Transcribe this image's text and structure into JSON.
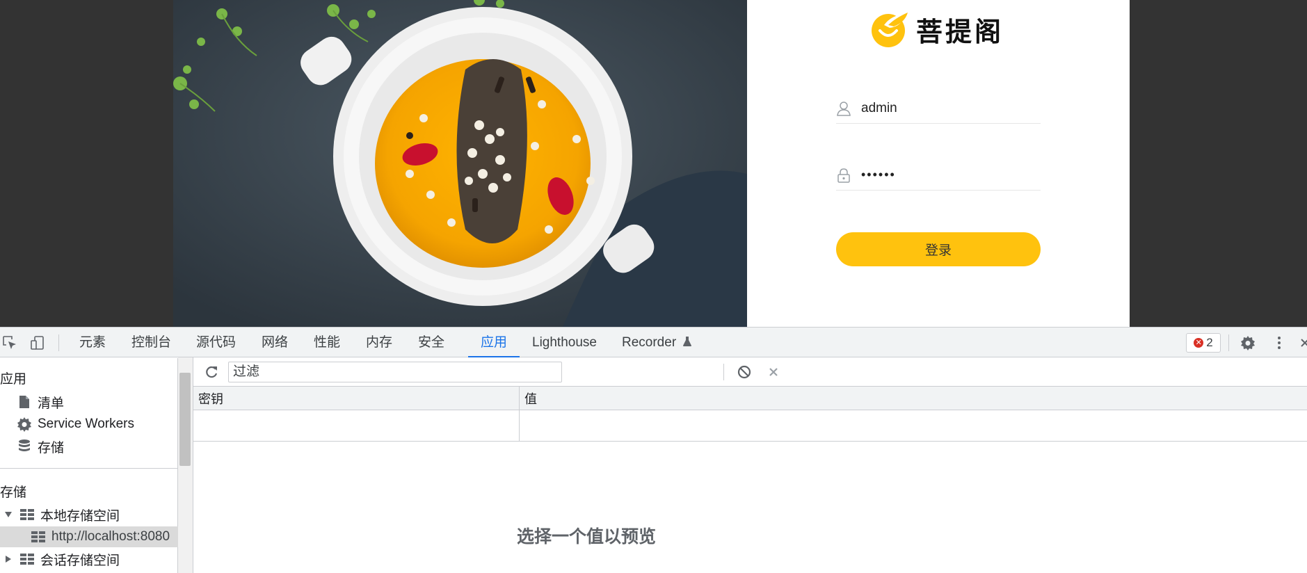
{
  "login_page": {
    "brand_name": "菩提阁",
    "username_value": "admin",
    "password_value": "••••••",
    "login_button_label": "登录",
    "accent_color": "#ffc20e"
  },
  "devtools": {
    "tabs": [
      {
        "label": "元素"
      },
      {
        "label": "控制台"
      },
      {
        "label": "源代码"
      },
      {
        "label": "网络"
      },
      {
        "label": "性能"
      },
      {
        "label": "内存"
      },
      {
        "label": "安全"
      },
      {
        "label": "应用",
        "active": true
      },
      {
        "label": "Lighthouse"
      },
      {
        "label": "Recorder"
      }
    ],
    "error_count": "2",
    "sidebar": {
      "section_app": "应用",
      "app_items": [
        {
          "label": "清单",
          "icon": "file-icon"
        },
        {
          "label": "Service Workers",
          "icon": "gear-icon"
        },
        {
          "label": "存储",
          "icon": "database-icon"
        }
      ],
      "section_storage": "存储",
      "storage_items": [
        {
          "label": "本地存储空间",
          "icon": "grid-icon",
          "expanded": true
        },
        {
          "label": "http://localhost:8080",
          "icon": "grid-icon",
          "selected": true
        },
        {
          "label": "会话存储空间",
          "icon": "grid-icon",
          "expanded": false
        }
      ]
    },
    "filter_placeholder": "过滤",
    "table": {
      "col_key": "密钥",
      "col_value": "值"
    },
    "preview_text": "选择一个值以预览"
  }
}
